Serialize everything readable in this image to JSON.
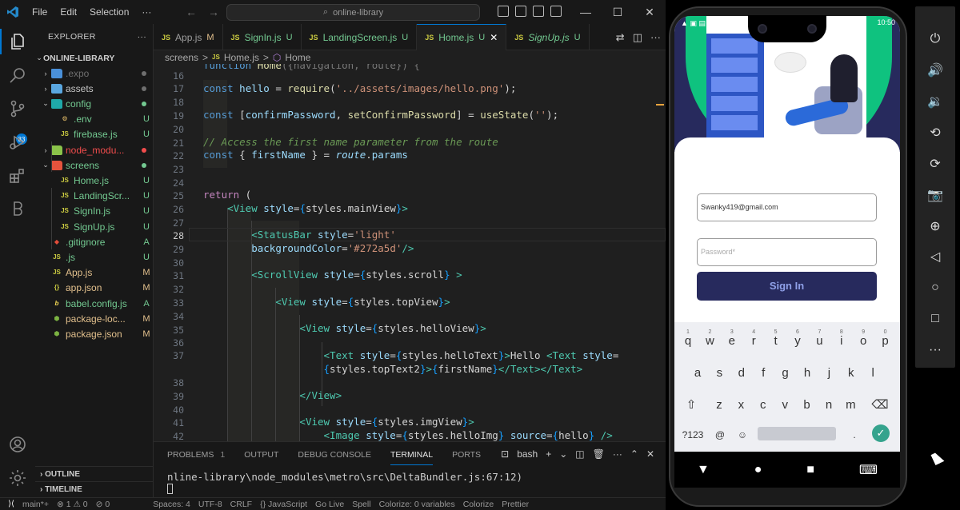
{
  "vscode": {
    "menu": [
      "File",
      "Edit",
      "Selection",
      "···"
    ],
    "search": "online-library",
    "window_controls": [
      "—",
      "☐",
      "✕"
    ]
  },
  "explorer": {
    "title": "EXPLORER",
    "project": "ONLINE-LIBRARY",
    "items": [
      {
        "name": ".expo",
        "status": "",
        "color": "#6f6f6f"
      },
      {
        "name": "assets",
        "status": "",
        "color": "#c5c5c5"
      },
      {
        "name": "config",
        "status": "",
        "color": "#73c991"
      },
      {
        "name": ".env",
        "status": "U",
        "color": "#73c991"
      },
      {
        "name": "firebase.js",
        "status": "U",
        "color": "#73c991"
      },
      {
        "name": "node_modu...",
        "status": "",
        "color": "#f14c4c"
      },
      {
        "name": "screens",
        "status": "",
        "color": "#73c991"
      },
      {
        "name": "Home.js",
        "status": "U",
        "color": "#73c991"
      },
      {
        "name": "LandingScr...",
        "status": "U",
        "color": "#73c991"
      },
      {
        "name": "SignIn.js",
        "status": "U",
        "color": "#73c991"
      },
      {
        "name": "SignUp.js",
        "status": "U",
        "color": "#73c991"
      },
      {
        "name": ".gitignore",
        "status": "A",
        "color": "#73c991"
      },
      {
        "name": ".js",
        "status": "U",
        "color": "#73c991"
      },
      {
        "name": "App.js",
        "status": "M",
        "color": "#e2c08d"
      },
      {
        "name": "app.json",
        "status": "M",
        "color": "#e2c08d"
      },
      {
        "name": "babel.config.js",
        "status": "A",
        "color": "#73c991"
      },
      {
        "name": "package-loc...",
        "status": "M",
        "color": "#e2c08d"
      },
      {
        "name": "package.json",
        "status": "M",
        "color": "#e2c08d"
      }
    ],
    "outline": "OUTLINE",
    "timeline": "TIMELINE",
    "scm_badge": "33"
  },
  "tabs": [
    {
      "label": "App.js",
      "status": "M"
    },
    {
      "label": "SignIn.js",
      "status": "U"
    },
    {
      "label": "LandingScreen.js",
      "status": "U"
    },
    {
      "label": "Home.js",
      "status": "U"
    },
    {
      "label": "SignUp.js",
      "status": "U"
    }
  ],
  "breadcrumb": [
    "screens",
    ">",
    "Home.js",
    ">",
    "Home"
  ],
  "editor": {
    "line_numbers": [
      "16",
      "17",
      "18",
      "19",
      "20",
      "21",
      "22",
      "23",
      "24",
      "25",
      "26",
      "27",
      "28",
      "29",
      "30",
      "31",
      "32",
      "33",
      "34",
      "35",
      "36",
      "37",
      "",
      "38",
      "39",
      "40",
      "41",
      "42"
    ],
    "current_line": "28"
  },
  "panel": {
    "tabs": [
      "PROBLEMS",
      "OUTPUT",
      "DEBUG CONSOLE",
      "TERMINAL",
      "PORTS"
    ],
    "problems_count": "1",
    "shell": "bash",
    "terminal_line": "nline-library\\node_modules\\metro\\src\\DeltaBundler.js:67:12)"
  },
  "statusbar": {
    "branch": "main*+",
    "errors": "⊗ 1 ⚠ 0",
    "info": "⊘ 0",
    "spaces": "Spaces: 4",
    "encoding": "UTF-8",
    "eol": "CRLF",
    "language": "{} JavaScript",
    "golive": "Go Live",
    "spell": "Spell",
    "colorize_vars": "Colorize: 0 variables",
    "colorize": "Colorize",
    "prettier": "Prettier"
  },
  "phone": {
    "time": "10:50",
    "email_value": "Swanky419@gmail.com",
    "password_placeholder": "Password*",
    "signin_label": "Sign In",
    "keyboard": {
      "row1": [
        "q",
        "w",
        "e",
        "r",
        "t",
        "y",
        "u",
        "i",
        "o",
        "p"
      ],
      "row1_nums": [
        "1",
        "2",
        "3",
        "4",
        "5",
        "6",
        "7",
        "8",
        "9",
        "0"
      ],
      "row2": [
        "a",
        "s",
        "d",
        "f",
        "g",
        "h",
        "j",
        "k",
        "l"
      ],
      "row3": [
        "z",
        "x",
        "c",
        "v",
        "b",
        "n",
        "m"
      ],
      "sym": "?123",
      "at": "@",
      "period": "."
    }
  },
  "colors": {
    "accent": "#0078d4",
    "app_primary": "#272a5d",
    "hero_green": "#0fc27f"
  }
}
